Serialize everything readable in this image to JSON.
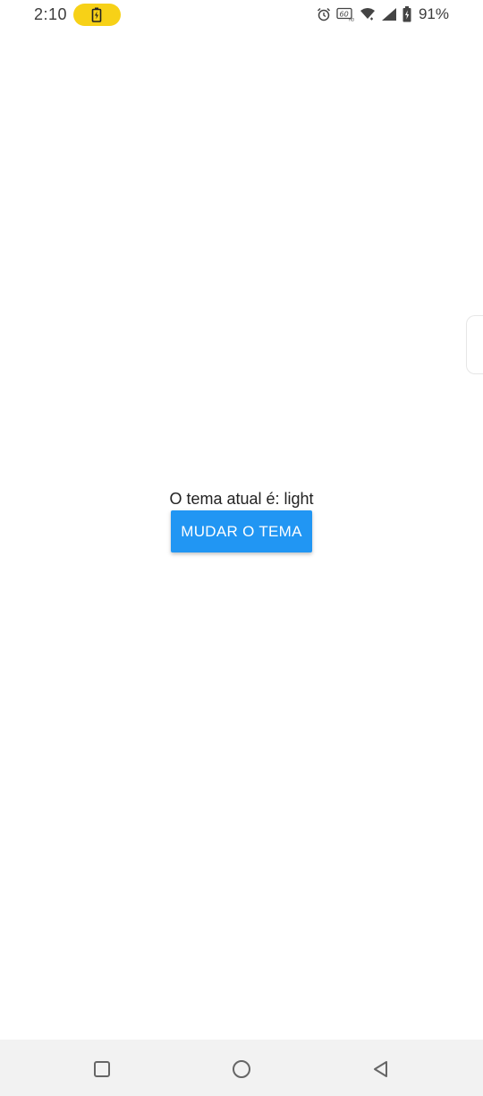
{
  "status_bar": {
    "time": "2:10",
    "battery_percent": "91%",
    "pill_color": "#f7d117",
    "icons": [
      "battery-charging-icon",
      "alarm-icon",
      "hd-voice-icon",
      "wifi-icon",
      "cell-signal-icon",
      "battery-icon"
    ]
  },
  "main": {
    "theme_label": "O tema atual é: light",
    "button_label": "MUDAR O TEMA",
    "accent_color": "#2196f3"
  },
  "nav_bar": {
    "icons": [
      "recents-square-icon",
      "home-circle-icon",
      "back-triangle-icon"
    ]
  }
}
